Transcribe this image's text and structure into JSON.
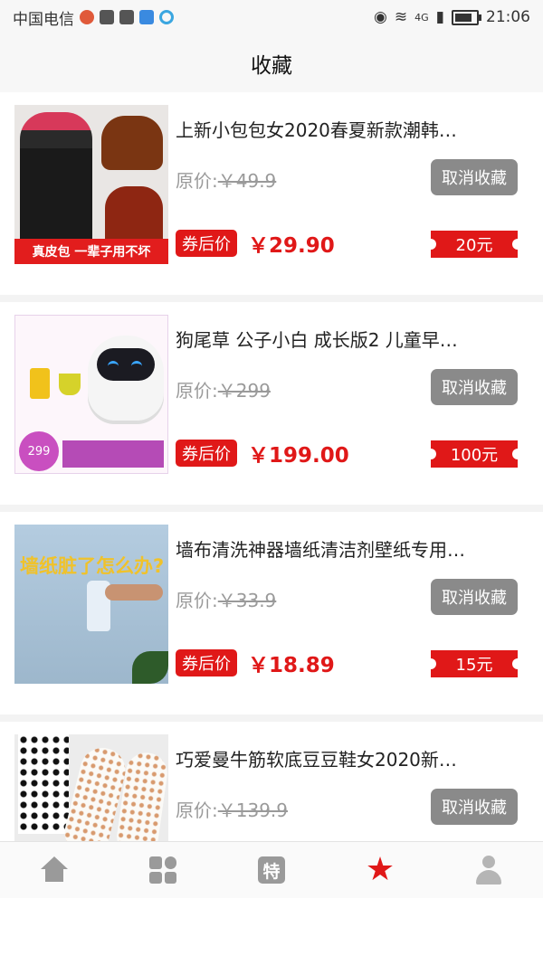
{
  "status_bar": {
    "carrier": "中国电信",
    "network": "4G",
    "time": "21:06"
  },
  "header": {
    "title": "收藏"
  },
  "labels": {
    "original_price_prefix": "原价:",
    "cancel_button": "取消收藏",
    "coupon_tag": "券后价"
  },
  "items": [
    {
      "title": "上新小包包女2020春夏新款潮韩…",
      "original_price": "￥49.9",
      "price": "￥29.90",
      "coupon": "20元",
      "thumb_banner": "真皮包 一辈子用不坏"
    },
    {
      "title": "狗尾草 公子小白 成长版2 儿童早…",
      "original_price": "￥299",
      "price": "￥199.00",
      "coupon": "100元",
      "thumb_badge": "299"
    },
    {
      "title": "墙布清洗神器墙纸清洁剂壁纸专用…",
      "original_price": "￥33.9",
      "price": "￥18.89",
      "coupon": "15元",
      "thumb_headline": "墙纸脏了怎么办?"
    },
    {
      "title": "巧爱曼牛筋软底豆豆鞋女2020新…",
      "original_price": "￥139.9"
    }
  ],
  "tabbar": {
    "icons": [
      "home-icon",
      "category-icon",
      "special-icon",
      "star-icon",
      "user-icon"
    ],
    "special_glyph": "特",
    "active": "favorites",
    "accent_color": "#e01818",
    "inactive_color": "#9a9a9a"
  }
}
